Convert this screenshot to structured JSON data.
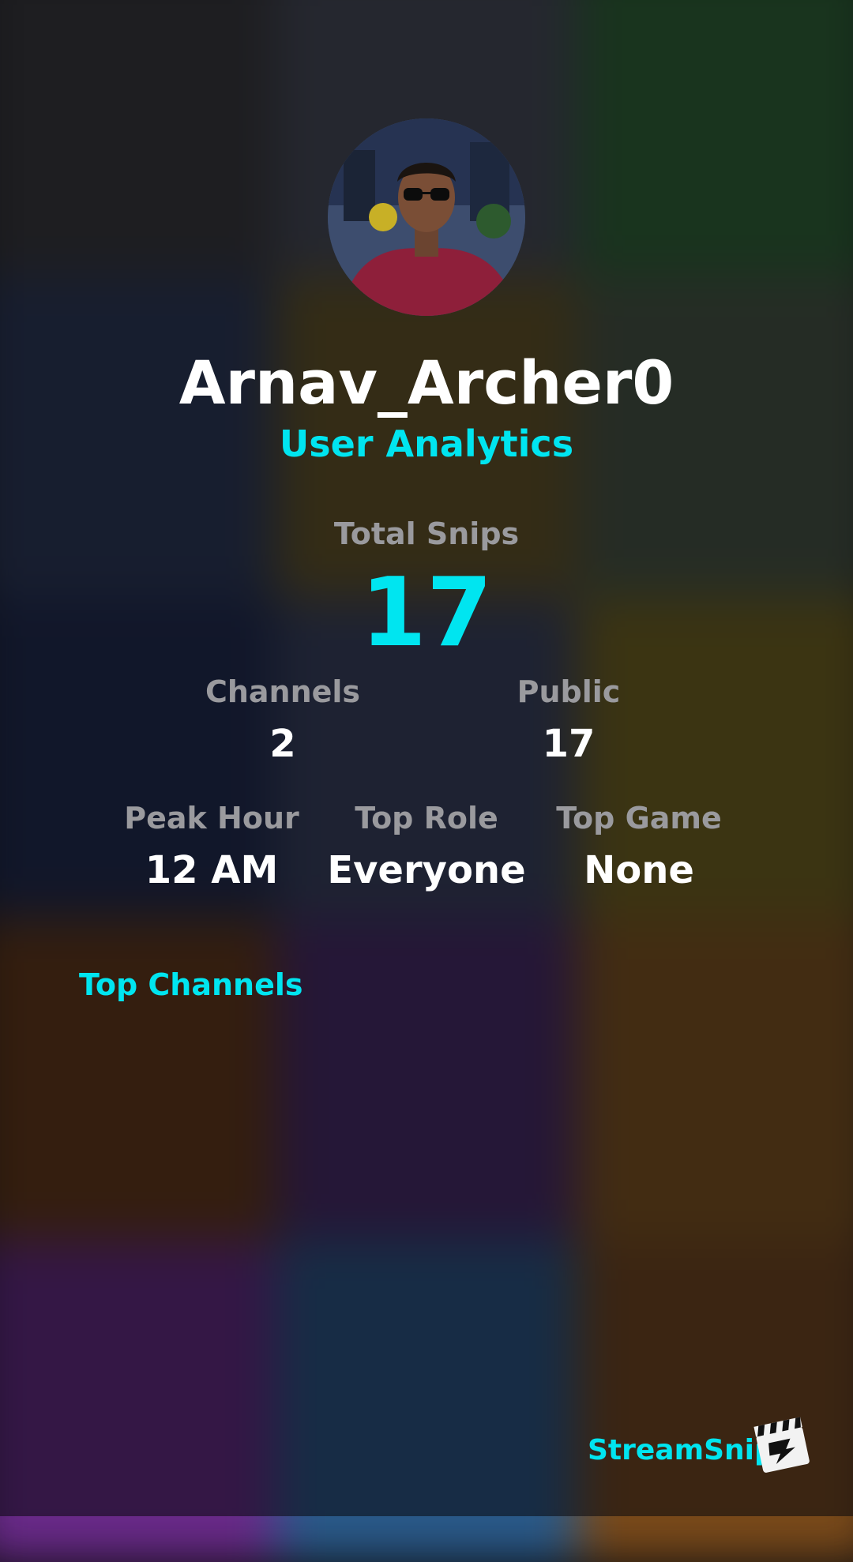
{
  "profile": {
    "username": "Arnav_Archer0",
    "subtitle": "User Analytics"
  },
  "stats": {
    "total_snips": {
      "label": "Total Snips",
      "value": "17"
    },
    "channels": {
      "label": "Channels",
      "value": "2"
    },
    "public": {
      "label": "Public",
      "value": "17"
    },
    "peak_hour": {
      "label": "Peak Hour",
      "value": "12 AM"
    },
    "top_role": {
      "label": "Top Role",
      "value": "Everyone"
    },
    "top_game": {
      "label": "Top Game",
      "value": "None"
    }
  },
  "sections": {
    "top_channels": "Top Channels"
  },
  "footer": {
    "brand": "StreamSnip"
  },
  "icons": {
    "brand_logo": "clapperboard-icon"
  },
  "colors": {
    "accent": "#00e5f0",
    "label": "#9a9a9e",
    "value": "#ffffff"
  }
}
